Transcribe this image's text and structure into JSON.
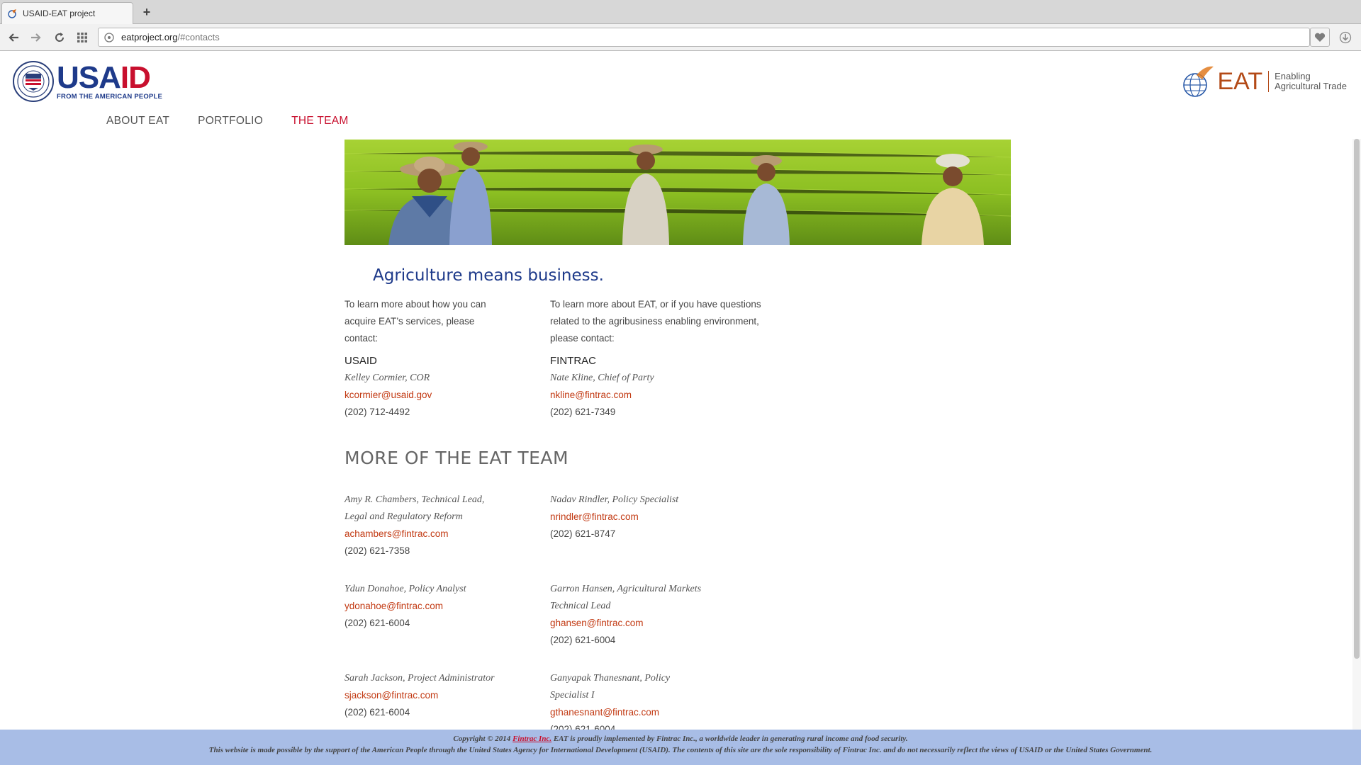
{
  "browser": {
    "tab_title": "USAID-EAT project",
    "new_tab_symbol": "+",
    "url_host": "eatproject.org",
    "url_path": "/#contacts"
  },
  "header": {
    "usaid_part1": "USA",
    "usaid_part2": "ID",
    "usaid_tagline": "FROM THE AMERICAN PEOPLE",
    "eat_word": "EAT",
    "eat_tagline_1": "Enabling",
    "eat_tagline_2": "Agricultural Trade"
  },
  "nav": [
    {
      "label": "ABOUT EAT",
      "active": false
    },
    {
      "label": "PORTFOLIO",
      "active": false
    },
    {
      "label": "THE TEAM",
      "active": true
    }
  ],
  "main": {
    "tagline": "Agriculture means business.",
    "intro_left": "To learn more about how you can acquire EAT’s services, please contact:",
    "intro_right": "To learn more about EAT, or if you have questions related to the agribusiness enabling environment, please contact:",
    "contacts": [
      {
        "org": "USAID",
        "person": "Kelley Cormier, COR",
        "email": "kcormier@usaid.gov",
        "phone": "(202) 712-4492"
      },
      {
        "org": "FINTRAC",
        "person": "Nate Kline, Chief of Party",
        "email": "nkline@fintrac.com",
        "phone": "(202) 621-7349"
      }
    ],
    "section_title": "MORE OF THE EAT TEAM",
    "team": [
      {
        "person_1": "Amy R. Chambers, Technical Lead,",
        "person_2": "Legal and Regulatory Reform",
        "email": "achambers@fintrac.com",
        "phone": "(202) 621-7358"
      },
      {
        "person_1": "Nadav Rindler, Policy Specialist",
        "person_2": "",
        "email": "nrindler@fintrac.com",
        "phone": "(202) 621-8747"
      },
      {
        "person_1": "Ydun Donahoe, Policy Analyst",
        "person_2": "",
        "email": "ydonahoe@fintrac.com",
        "phone": "(202) 621-6004"
      },
      {
        "person_1": "Garron Hansen, Agricultural Markets",
        "person_2": "Technical Lead",
        "email": "ghansen@fintrac.com",
        "phone": "(202) 621-6004"
      },
      {
        "person_1": "Sarah Jackson, Project Administrator",
        "person_2": "",
        "email": "sjackson@fintrac.com",
        "phone": "(202) 621-6004"
      },
      {
        "person_1": "Ganyapak Thanesnant, Policy",
        "person_2": "Specialist I",
        "email": "gthanesnant@fintrac.com",
        "phone": "(202) 621-6004"
      }
    ]
  },
  "footer": {
    "line1_pre": "Copyright © 2014 ",
    "line1_brand": "Fintrac Inc.",
    "line1_post": " EAT is proudly implemented by Fintrac Inc., a worldwide leader in generating rural income and food security.",
    "line2": "This website is made possible by the support of the American People through the United States Agency for International Development (USAID). The contents of this site are the sole responsibility of Fintrac Inc. and do not necessarily reflect the views of USAID or the United States Government."
  },
  "colors": {
    "usaid_blue": "#1e3a8a",
    "usaid_red": "#c8102e",
    "link": "#c23912",
    "footer_bg": "#a8bde6"
  }
}
